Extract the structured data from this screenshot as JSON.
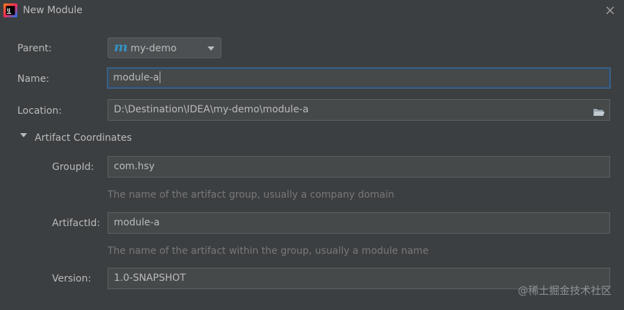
{
  "window": {
    "title": "New Module",
    "app_icon": "intellij-idea-icon",
    "close_icon": "close-icon"
  },
  "form": {
    "parent": {
      "label": "Parent:",
      "icon": "maven-icon",
      "icon_glyph": "m",
      "value": "my-demo"
    },
    "name": {
      "label": "Name:",
      "value": "module-a"
    },
    "location": {
      "label": "Location:",
      "value": "D:\\Destination\\IDEA\\my-demo\\module-a",
      "browse_icon": "folder-icon"
    }
  },
  "artifact_section": {
    "title": "Artifact Coordinates",
    "expanded": true,
    "group_id": {
      "label": "GroupId:",
      "value": "com.hsy",
      "hint": "The name of the artifact group, usually a company domain"
    },
    "artifact_id": {
      "label": "ArtifactId:",
      "value": "module-a",
      "hint": "The name of the artifact within the group, usually a module name"
    },
    "version": {
      "label": "Version:",
      "value": "1.0-SNAPSHOT"
    }
  },
  "watermark": "@稀土掘金技术社区",
  "colors": {
    "background": "#3c3f41",
    "field_background": "#45494a",
    "field_border": "#5e6060",
    "focus_border": "#3d6185",
    "text": "#bbbbbb",
    "hint_text": "#787878",
    "maven_accent": "#3592c4"
  }
}
